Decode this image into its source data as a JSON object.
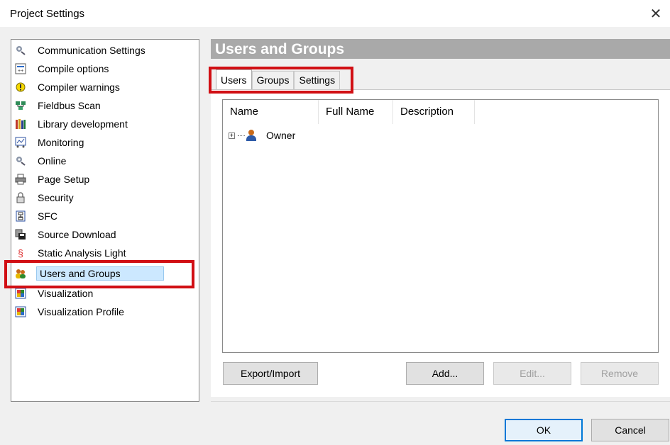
{
  "window": {
    "title": "Project Settings",
    "close_glyph": "✕"
  },
  "tree": {
    "items": [
      {
        "label": "Communication Settings",
        "icon": "gear-icon"
      },
      {
        "label": "Compile options",
        "icon": "compile-icon"
      },
      {
        "label": "Compiler warnings",
        "icon": "warning-icon"
      },
      {
        "label": "Fieldbus Scan",
        "icon": "fieldbus-icon"
      },
      {
        "label": "Library development",
        "icon": "library-icon"
      },
      {
        "label": "Monitoring",
        "icon": "monitor-icon"
      },
      {
        "label": "Online",
        "icon": "gear-icon"
      },
      {
        "label": "Page Setup",
        "icon": "printer-icon"
      },
      {
        "label": "Security",
        "icon": "lock-icon"
      },
      {
        "label": "SFC",
        "icon": "sfc-icon"
      },
      {
        "label": "Source Download",
        "icon": "download-icon"
      },
      {
        "label": "Static Analysis Light",
        "icon": "section-icon"
      },
      {
        "label": "Users and Groups",
        "icon": "users-icon"
      },
      {
        "label": "Visualization",
        "icon": "visualization-icon"
      },
      {
        "label": "Visualization Profile",
        "icon": "visualization-icon"
      }
    ],
    "selected": "Users and Groups"
  },
  "panel": {
    "title": "Users and Groups",
    "tabs": [
      {
        "label": "Users",
        "active": true
      },
      {
        "label": "Groups",
        "active": false
      },
      {
        "label": "Settings",
        "active": false
      }
    ],
    "columns": [
      "Name",
      "Full Name",
      "Description"
    ],
    "rows": [
      {
        "name": "Owner",
        "expander": "+"
      }
    ],
    "buttons": {
      "export_import": "Export/Import",
      "add": "Add...",
      "edit": "Edit...",
      "remove": "Remove"
    }
  },
  "footer": {
    "ok": "OK",
    "cancel": "Cancel"
  },
  "colors": {
    "highlight": "#d10f14",
    "header_bar": "#a9a9a9",
    "selection": "#cce8ff",
    "default_button_border": "#0078d7"
  }
}
